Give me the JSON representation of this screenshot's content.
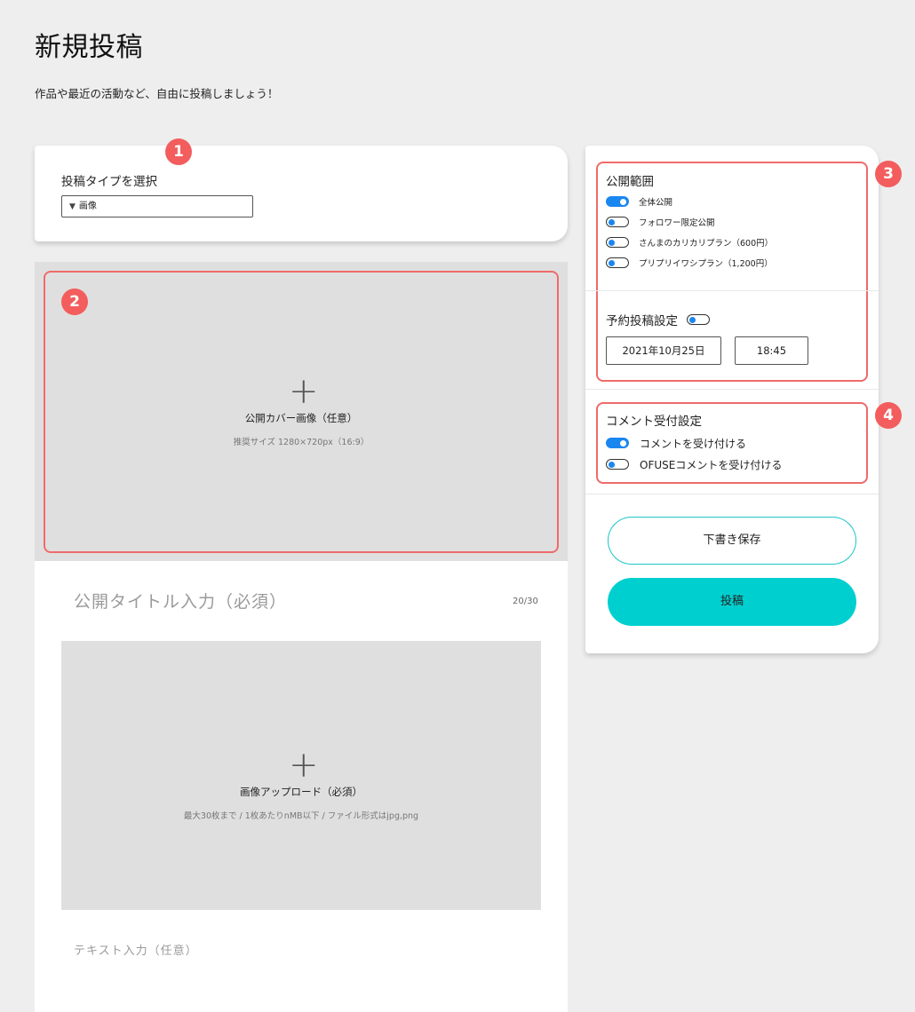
{
  "header": {
    "title": "新規投稿",
    "subtitle": "作品や最近の活動など、自由に投稿しましょう！"
  },
  "markers": [
    "1",
    "2",
    "3",
    "4"
  ],
  "post_type": {
    "label": "投稿タイプを選択",
    "selected": "画像",
    "arrow": "▼"
  },
  "cover": {
    "plus": "+",
    "title": "公開カバー画像（任意）",
    "hint": "推奨サイズ 1280×720px（16:9）"
  },
  "title_input": {
    "placeholder": "公開タイトル入力（必須）",
    "count": "20/30"
  },
  "image_upload": {
    "plus": "+",
    "title": "画像アップロード（必須）",
    "hint": "最大30枚まで / 1枚あたりnMB以下 / ファイル形式はjpg,png"
  },
  "text_input": {
    "placeholder": "テキスト入力（任意）"
  },
  "visibility": {
    "title": "公開範囲",
    "options": [
      {
        "label": "全体公開",
        "on": true
      },
      {
        "label": "フォロワー限定公開",
        "on": false
      },
      {
        "label": "さんまのカリカリプラン（600円）",
        "on": false
      },
      {
        "label": "プリプリイワシプラン（1,200円）",
        "on": false
      }
    ]
  },
  "schedule": {
    "title": "予約投稿設定",
    "on": false,
    "date": "2021年10月25日",
    "time": "18:45"
  },
  "comments": {
    "title": "コメント受付設定",
    "options": [
      {
        "label": "コメントを受け付ける",
        "on": true
      },
      {
        "label": "OFUSEコメントを受け付ける",
        "on": false
      }
    ]
  },
  "actions": {
    "draft_label": "下書き保存",
    "post_label": "投稿"
  },
  "colors": {
    "accent_teal": "#00cfd0",
    "toggle_blue": "#1a86f0",
    "highlight_red": "#ef6b6b",
    "marker_red": "#f35d5d"
  }
}
